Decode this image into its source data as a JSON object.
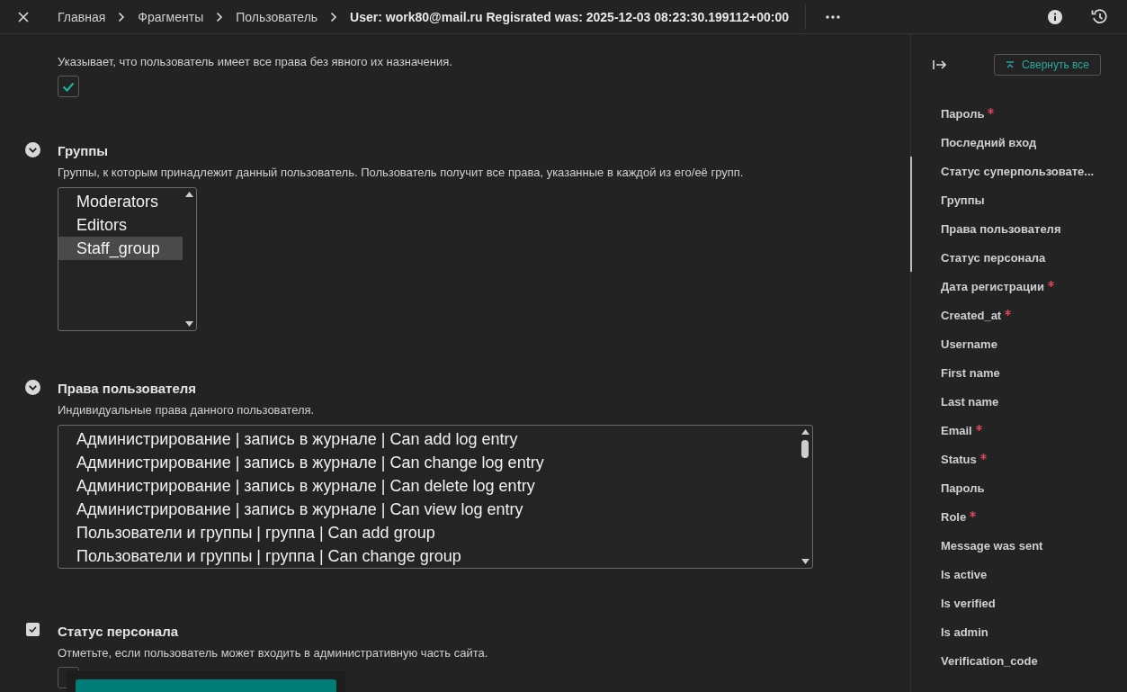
{
  "breadcrumbs": [
    {
      "label": "Главная",
      "current": false
    },
    {
      "label": "Фрагменты",
      "current": false
    },
    {
      "label": "Пользователь",
      "current": false
    },
    {
      "label": "User: work80@mail.ru Regisrated was: 2025-12-03 08:23:30.199112+00:00",
      "current": true
    }
  ],
  "sections": [
    {
      "description": "Указывает, что пользователь имеет все права без явного их назначения.",
      "field": {
        "kind": "checkbox",
        "checked": true
      }
    },
    {
      "kind": "collapse",
      "title": "Группы",
      "description": "Группы, к которым принадлежит данный пользователь. Пользователь получит все права, указанные в каждой из его/её групп.",
      "field": {
        "kind": "list",
        "options": [
          {
            "label": "Moderators",
            "selected": false
          },
          {
            "label": "Editors",
            "selected": false
          },
          {
            "label": "Staff_group",
            "selected": true
          }
        ]
      }
    },
    {
      "kind": "collapse",
      "title": "Права пользователя",
      "description": "Индивидуальные права данного пользователя.",
      "field": {
        "kind": "widelist",
        "options": [
          {
            "label": "Администрирование | запись в журнале | Can add log entry",
            "selected": false
          },
          {
            "label": "Администрирование | запись в журнале | Can change log entry",
            "selected": false
          },
          {
            "label": "Администрирование | запись в журнале | Can delete log entry",
            "selected": false
          },
          {
            "label": "Администрирование | запись в журнале | Can view log entry",
            "selected": false
          },
          {
            "label": "Пользователи и группы | группа | Can add group",
            "selected": false
          },
          {
            "label": "Пользователи и группы | группа | Can change group",
            "selected": false
          }
        ]
      }
    },
    {
      "kind": "checkbox",
      "title": "Статус персонала",
      "description": "Отметьте, если пользователь может входить в административную часть сайта.",
      "field": {
        "kind": "checkbox",
        "checked": false
      }
    }
  ],
  "outline": {
    "collapse_button": "Свернуть все",
    "items": [
      {
        "label": "Пароль",
        "required": true,
        "in_view": false
      },
      {
        "label": "Последний вход",
        "required": false,
        "in_view": false
      },
      {
        "label": "Статус суперпользовате...",
        "required": false,
        "in_view": true
      },
      {
        "label": "Группы",
        "required": false,
        "in_view": true
      },
      {
        "label": "Права пользователя",
        "required": false,
        "in_view": true
      },
      {
        "label": "Статус персонала",
        "required": false,
        "in_view": true
      },
      {
        "label": "Дата регистрации",
        "required": true,
        "in_view": false
      },
      {
        "label": "Created_at",
        "required": true,
        "in_view": false
      },
      {
        "label": "Username",
        "required": false,
        "in_view": false
      },
      {
        "label": "First name",
        "required": false,
        "in_view": false
      },
      {
        "label": "Last name",
        "required": false,
        "in_view": false
      },
      {
        "label": "Email",
        "required": true,
        "in_view": false
      },
      {
        "label": "Status",
        "required": true,
        "in_view": false
      },
      {
        "label": "Пароль",
        "required": false,
        "in_view": false
      },
      {
        "label": "Role",
        "required": true,
        "in_view": false
      },
      {
        "label": "Message was sent",
        "required": false,
        "in_view": false
      },
      {
        "label": "Is active",
        "required": false,
        "in_view": false
      },
      {
        "label": "Is verified",
        "required": false,
        "in_view": false
      },
      {
        "label": "Is admin",
        "required": false,
        "in_view": false
      },
      {
        "label": "Verification_code",
        "required": false,
        "in_view": false
      }
    ]
  }
}
